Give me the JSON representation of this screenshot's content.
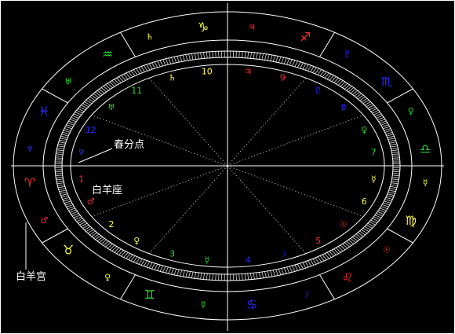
{
  "colors": {
    "background": "#000000",
    "lines": "#ffffff",
    "fire": "#ff2b2b",
    "earth": "#ffff40",
    "air": "#2bdc2b",
    "water": "#2a2aff"
  },
  "zodiac_signs": [
    {
      "name": "aries-icon",
      "symbol": "♈",
      "element": "fire"
    },
    {
      "name": "taurus-icon",
      "symbol": "♉",
      "element": "earth"
    },
    {
      "name": "gemini-icon",
      "symbol": "♊",
      "element": "air"
    },
    {
      "name": "cancer-icon",
      "symbol": "♋",
      "element": "water"
    },
    {
      "name": "leo-icon",
      "symbol": "♌",
      "element": "fire"
    },
    {
      "name": "virgo-icon",
      "symbol": "♍",
      "element": "earth"
    },
    {
      "name": "libra-icon",
      "symbol": "♎",
      "element": "air"
    },
    {
      "name": "scorpio-icon",
      "symbol": "♏",
      "element": "water"
    },
    {
      "name": "sagittarius-icon",
      "symbol": "♐",
      "element": "fire"
    },
    {
      "name": "capricorn-icon",
      "symbol": "♑",
      "element": "earth"
    },
    {
      "name": "aquarius-icon",
      "symbol": "♒",
      "element": "air"
    },
    {
      "name": "pisces-icon",
      "symbol": "♓",
      "element": "water"
    }
  ],
  "sign_rulers": [
    {
      "name": "mars-icon",
      "symbol": "♂"
    },
    {
      "name": "venus-icon",
      "symbol": "♀"
    },
    {
      "name": "mercury-icon",
      "symbol": "☿"
    },
    {
      "name": "moon-icon",
      "symbol": "☽"
    },
    {
      "name": "sun-icon",
      "symbol": "☉"
    },
    {
      "name": "mercury-icon",
      "symbol": "☿"
    },
    {
      "name": "venus-icon",
      "symbol": "♀"
    },
    {
      "name": "pluto-icon",
      "symbol": "♇"
    },
    {
      "name": "jupiter-icon",
      "symbol": "♃"
    },
    {
      "name": "saturn-icon",
      "symbol": "♄"
    },
    {
      "name": "uranus-icon",
      "symbol": "♅"
    },
    {
      "name": "neptune-icon",
      "symbol": "♆"
    }
  ],
  "houses": [
    {
      "number": "1",
      "ruler": "♂"
    },
    {
      "number": "2",
      "ruler": "♀"
    },
    {
      "number": "3",
      "ruler": "☿"
    },
    {
      "number": "4",
      "ruler": "☽"
    },
    {
      "number": "5",
      "ruler": "☉"
    },
    {
      "number": "6",
      "ruler": "☿"
    },
    {
      "number": "7",
      "ruler": "♀"
    },
    {
      "number": "8",
      "ruler": "♇"
    },
    {
      "number": "9",
      "ruler": "♃"
    },
    {
      "number": "10",
      "ruler": "♄"
    },
    {
      "number": "11",
      "ruler": "♅"
    },
    {
      "number": "12",
      "ruler": "♆"
    }
  ],
  "annotations": {
    "vernal_equinox": "春分点",
    "aries_sign": "白羊座",
    "aries_house": "白羊宫"
  }
}
